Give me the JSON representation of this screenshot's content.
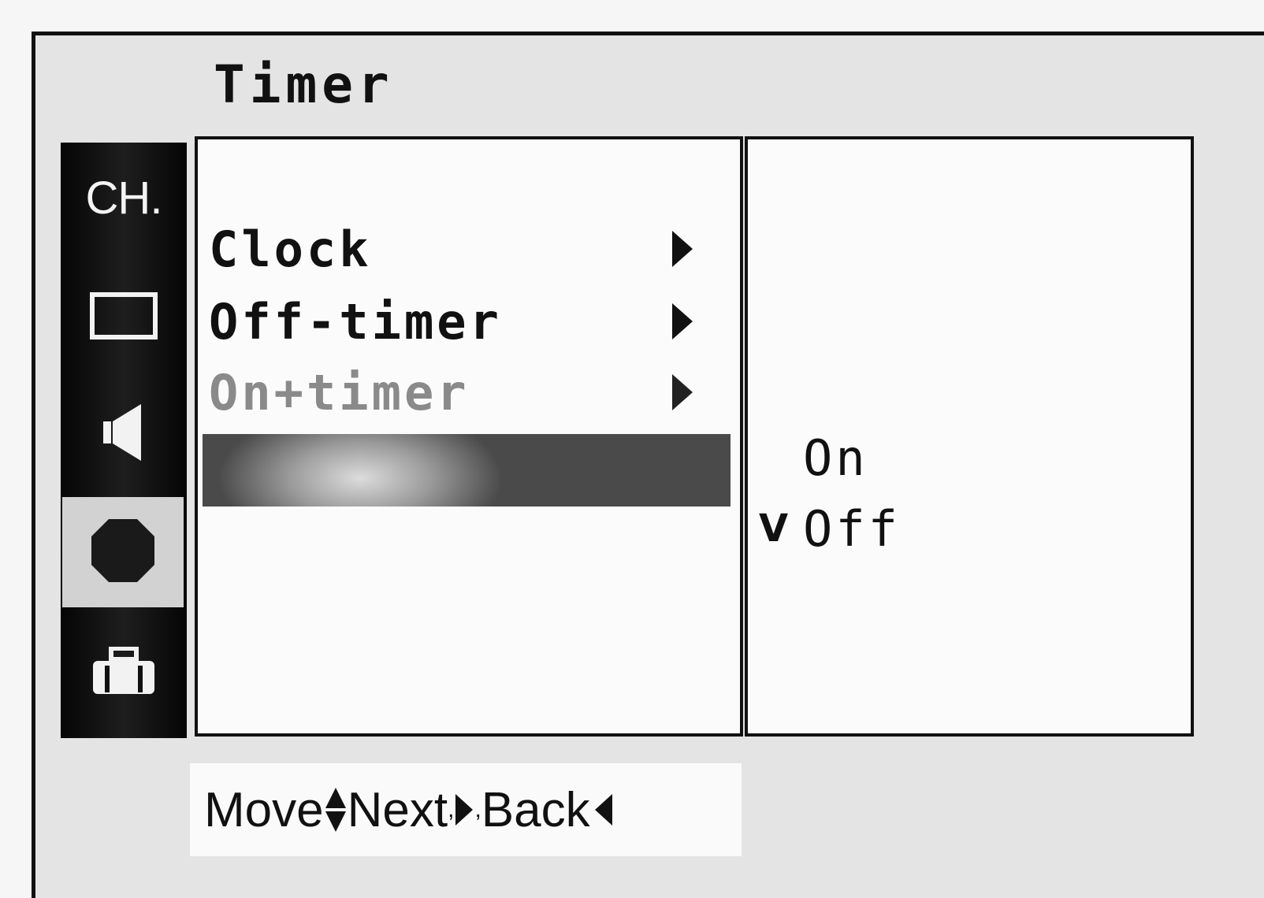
{
  "menu": {
    "title": "Timer"
  },
  "sidebar": {
    "items": [
      {
        "label": "CH.",
        "icon": "channel-text",
        "selected": false
      },
      {
        "label": "",
        "icon": "picture-icon",
        "selected": false
      },
      {
        "label": "",
        "icon": "speaker-icon",
        "selected": false
      },
      {
        "label": "",
        "icon": "timer-octagon-icon",
        "selected": true
      },
      {
        "label": "",
        "icon": "briefcase-icon",
        "selected": false
      }
    ]
  },
  "list": {
    "items": [
      {
        "label": "Clock",
        "dim": false
      },
      {
        "label": "Off-timer",
        "dim": false
      },
      {
        "label": "On+timer",
        "dim": true
      },
      {
        "label": "",
        "dim": false
      }
    ]
  },
  "options": {
    "items": [
      {
        "label": "On",
        "checked": false
      },
      {
        "label": "Off",
        "checked": true,
        "check_mark": "V"
      }
    ]
  },
  "help": {
    "move": "Move",
    "next": "Next",
    "back": "Back",
    "comma": ","
  }
}
